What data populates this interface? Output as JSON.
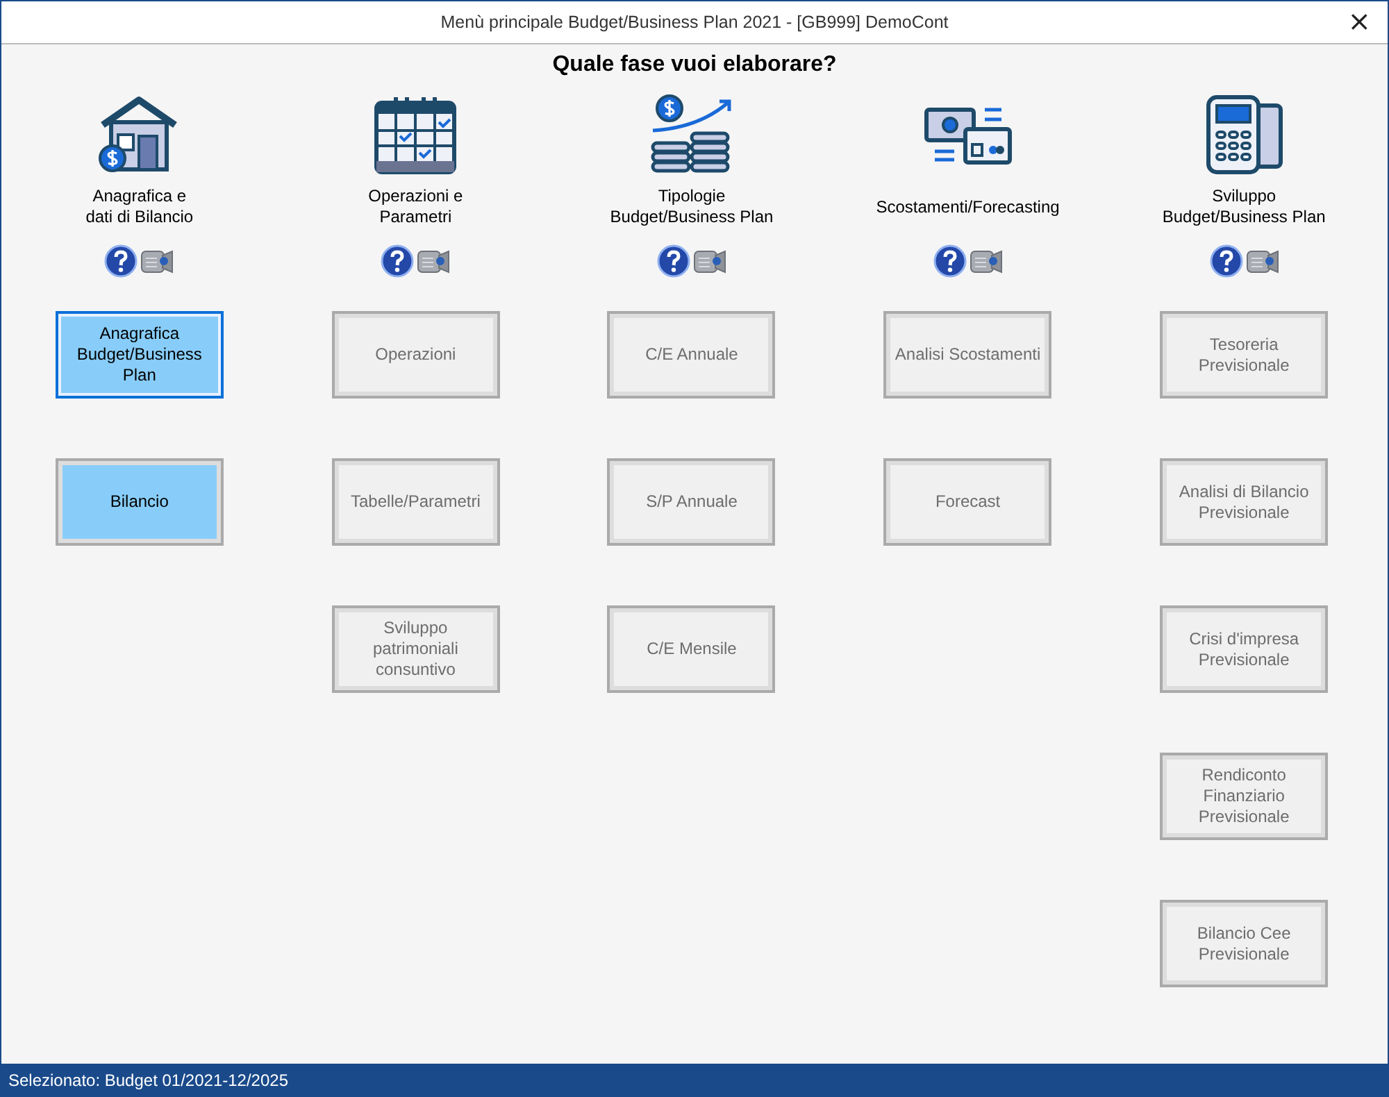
{
  "window": {
    "title": "Menù principale Budget/Business Plan 2021 - [GB999] DemoCont",
    "close": "×"
  },
  "heading": "Quale fase vuoi elaborare?",
  "columns": [
    {
      "label": "Anagrafica e\ndati di Bilancio",
      "buttons": [
        {
          "label": "Anagrafica\nBudget/Business\nPlan",
          "disabled": false,
          "selected": true
        },
        {
          "label": "Bilancio",
          "disabled": false,
          "selected": false
        }
      ]
    },
    {
      "label": "Operazioni e\nParametri",
      "buttons": [
        {
          "label": "Operazioni",
          "disabled": true,
          "selected": false
        },
        {
          "label": "Tabelle/Parametri",
          "disabled": true,
          "selected": false
        },
        {
          "label": "Sviluppo\npatrimoniali\nconsuntivo",
          "disabled": true,
          "selected": false
        }
      ]
    },
    {
      "label": "Tipologie\nBudget/Business Plan",
      "buttons": [
        {
          "label": "C/E Annuale",
          "disabled": true,
          "selected": false
        },
        {
          "label": "S/P Annuale",
          "disabled": true,
          "selected": false
        },
        {
          "label": "C/E Mensile",
          "disabled": true,
          "selected": false
        }
      ]
    },
    {
      "label": "Scostamenti/Forecasting",
      "buttons": [
        {
          "label": "Analisi Scostamenti",
          "disabled": true,
          "selected": false
        },
        {
          "label": "Forecast",
          "disabled": true,
          "selected": false
        }
      ]
    },
    {
      "label": "Sviluppo\nBudget/Business Plan",
      "buttons": [
        {
          "label": "Tesoreria\nPrevisionale",
          "disabled": true,
          "selected": false
        },
        {
          "label": "Analisi di Bilancio\nPrevisionale",
          "disabled": true,
          "selected": false
        },
        {
          "label": "Crisi d'impresa\nPrevisionale",
          "disabled": true,
          "selected": false
        },
        {
          "label": "Rendiconto\nFinanziario\nPrevisionale",
          "disabled": true,
          "selected": false
        },
        {
          "label": "Bilancio Cee\nPrevisionale",
          "disabled": true,
          "selected": false
        }
      ]
    }
  ],
  "status_bar": "Selezionato: Budget 01/2021-12/2025"
}
